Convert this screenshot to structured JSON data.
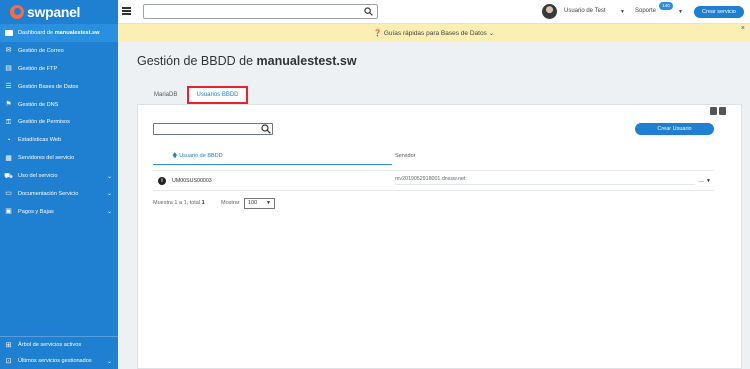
{
  "brand": {
    "name": "swpanel"
  },
  "sidebar": {
    "items": [
      {
        "label_pre": "Dashboard de ",
        "label_bold": "manualestest.sw",
        "icon": "dashboard-icon",
        "active": true
      },
      {
        "label": "Gestión de Correo",
        "icon": "mail-icon"
      },
      {
        "label": "Gestión de FTP",
        "icon": "ftp-icon"
      },
      {
        "label": "Gestión Bases de Datos",
        "icon": "database-icon"
      },
      {
        "label": "Gestión de DNS",
        "icon": "flag-icon"
      },
      {
        "label": "Gestión de Permisos",
        "icon": "key-icon"
      },
      {
        "label": "Estadísticas Web",
        "icon": "pie-chart-icon"
      },
      {
        "label": "Servidores del servicio",
        "icon": "server-icon"
      },
      {
        "label": "Uso del servicio",
        "icon": "cart-icon",
        "chevron": true
      },
      {
        "label": "Documentación Servicio",
        "icon": "document-icon",
        "chevron": true
      },
      {
        "label": "Pagos y Bajas",
        "icon": "payment-icon",
        "chevron": true
      }
    ],
    "bottom": [
      {
        "label": "Árbol de servicios activos",
        "icon": "tree-icon"
      },
      {
        "label": "Últimos servicios gestionados",
        "icon": "history-icon",
        "chevron": true
      }
    ]
  },
  "topbar": {
    "search_value": "",
    "user_name": "Usuario de Test",
    "support_label": "Soporte",
    "support_badge": "140",
    "create_service": "Crear servicio"
  },
  "banner": {
    "text": "Guías rápidas para Bases de Datos",
    "close": "×"
  },
  "page": {
    "title_pre": "Gestión de BBDD de ",
    "title_bold": "manualestest.sw"
  },
  "tabs": {
    "mariadb": "MariaDB",
    "users": "Usuarios BBDD"
  },
  "panel": {
    "search_value": "",
    "create_user": "Crear Usuario",
    "columns": {
      "user": "Usuario de BBDD",
      "server": "Servidor"
    },
    "rows": [
      {
        "user": "UM00SUS00003",
        "server": "mv2019052918001.dnssw.net",
        "menu": "..."
      }
    ],
    "footer_info_pre": "Muestra 1 a 1, total ",
    "footer_info_total": "1",
    "show_label": "Mostrar",
    "show_value": "100"
  },
  "colors": {
    "primary": "#1f7fd0",
    "banner": "#fbefb3",
    "highlight": "#e3262b"
  }
}
